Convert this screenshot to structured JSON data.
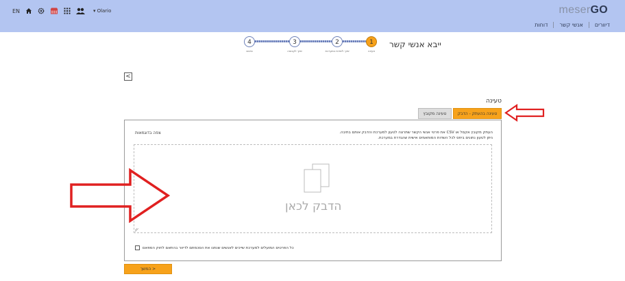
{
  "header": {
    "lang": "EN",
    "user": "Olario",
    "logo_left": "meser",
    "logo_right": "GO",
    "nav": [
      "דיוורים",
      "אנשי קשר",
      "דוחות"
    ]
  },
  "wizard": {
    "title": "ייבא אנשי קשר",
    "steps": [
      {
        "num": "1",
        "label": "טעינה"
      },
      {
        "num": "2",
        "label": "שיוך לשדות במערכת"
      },
      {
        "num": "3",
        "label": "שיוך לקבוצה"
      },
      {
        "num": "4",
        "label": "סיכום"
      }
    ]
  },
  "back_label": "<",
  "section_title": "טעינה",
  "tabs": {
    "paste": "טעינה בהעתק - הדבק",
    "file": "טעינה מקובץ"
  },
  "panel": {
    "instr_line1": "העתק מקובץ אקסל או CSV את פרטי אנשי הקשר שתרצה לטעון למערכת והדבק אותם בתיבה.",
    "instr_line2": "ניתן לטעון נתונים ביחס לכל השדות המותאמים אישית שהגדרת במערכת.",
    "example_link": "צפה בדוגמאות",
    "paste_label": "הדבק לכאן",
    "consent": "כל הפרטים המועלים למערכת שייכים לאנשים שנתנו את הסכמתם לדיוור בהתאם לחוק הספאם"
  },
  "continue_label": "המשך  >",
  "colors": {
    "header_bg": "#b3c5f1",
    "accent": "#f7a21b",
    "annotation": "#e02020"
  }
}
